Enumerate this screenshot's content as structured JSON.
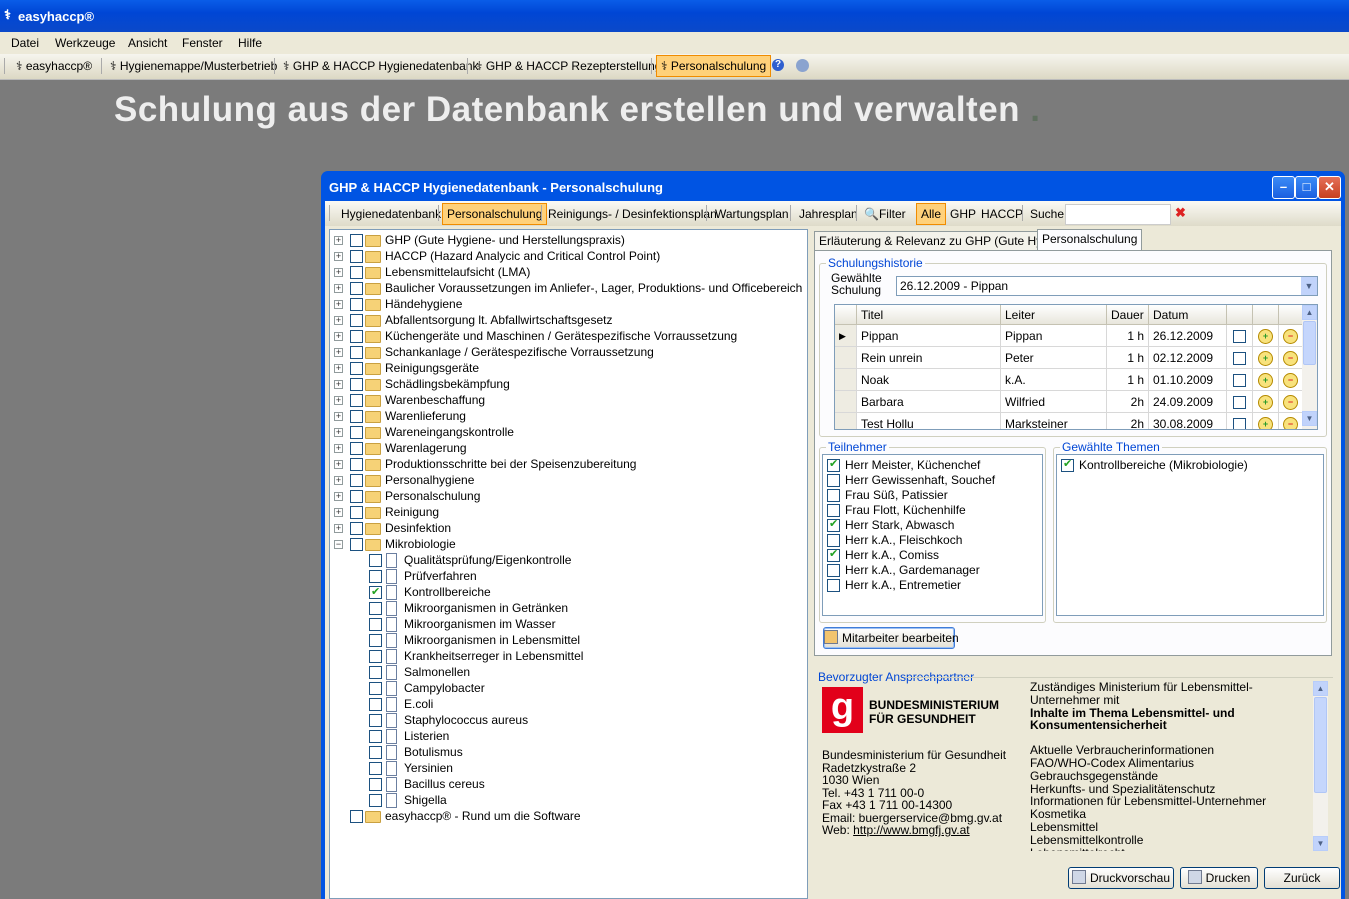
{
  "app": {
    "title": "easyhaccp®"
  },
  "menu": [
    "Datei",
    "Werkzeuge",
    "Ansicht",
    "Fenster",
    "Hilfe"
  ],
  "toolbar": {
    "items": [
      "easyhaccp®",
      "Hygienemappe/Musterbetrieb",
      "GHP & HACCP Hygienedatenbank",
      "GHP & HACCP Rezepterstellung",
      "Personalschulung"
    ],
    "active": "Personalschulung"
  },
  "headline": {
    "text": "Schulung aus der Datenbank erstellen  und verwalten",
    "dot": "."
  },
  "window": {
    "title": "GHP & HACCP Hygienedatenbank - Personalschulung",
    "toolbar": [
      "Hygienedatenbank",
      "Personalschulung",
      "Reinigungs- / Desinfektionsplan",
      "Wartungsplan",
      "Jahresplan",
      "Filter",
      "Alle",
      "GHP",
      "HACCP",
      "Suche"
    ],
    "search_value": ""
  },
  "tree": {
    "top": [
      {
        "label": "GHP (Gute Hygiene- und Herstellungspraxis)",
        "checked": false
      },
      {
        "label": "HACCP (Hazard Analycic and Critical Control Point)",
        "checked": false
      },
      {
        "label": "Lebensmittelaufsicht (LMA)",
        "checked": false
      },
      {
        "label": "Baulicher Voraussetzungen im Anliefer-, Lager, Produktions- und Officebereich",
        "checked": false
      },
      {
        "label": "Händehygiene",
        "checked": false
      },
      {
        "label": "Abfallentsorgung lt. Abfallwirtschaftsgesetz",
        "checked": false
      },
      {
        "label": "Küchengeräte und Maschinen / Gerätespezifische Vorraussetzung",
        "checked": false
      },
      {
        "label": "Schankanlage / Gerätespezifische Vorraussetzung",
        "checked": false
      },
      {
        "label": "Reinigungsgeräte",
        "checked": false
      },
      {
        "label": "Schädlingsbekämpfung",
        "checked": false
      },
      {
        "label": "Warenbeschaffung",
        "checked": false
      },
      {
        "label": "Warenlieferung",
        "checked": false
      },
      {
        "label": "Wareneingangskontrolle",
        "checked": false
      },
      {
        "label": "Warenlagerung",
        "checked": false
      },
      {
        "label": "Produktionsschritte bei der Speisenzubereitung",
        "checked": false
      },
      {
        "label": "Personalhygiene",
        "checked": false
      },
      {
        "label": "Personalschulung",
        "checked": false
      },
      {
        "label": "Reinigung",
        "checked": false
      },
      {
        "label": "Desinfektion",
        "checked": false
      },
      {
        "label": "Mikrobiologie",
        "checked": false,
        "expanded": true
      }
    ],
    "children": [
      {
        "label": "Qualitätsprüfung/Eigenkontrolle",
        "checked": false
      },
      {
        "label": "Prüfverfahren",
        "checked": false
      },
      {
        "label": "Kontrollbereiche",
        "checked": true
      },
      {
        "label": "Mikroorganismen in Getränken",
        "checked": false
      },
      {
        "label": "Mikroorganismen im Wasser",
        "checked": false
      },
      {
        "label": "Mikroorganismen in Lebensmittel",
        "checked": false
      },
      {
        "label": "Krankheitserreger in Lebensmittel",
        "checked": false
      },
      {
        "label": "Salmonellen",
        "checked": false
      },
      {
        "label": "Campylobacter",
        "checked": false
      },
      {
        "label": "E.coli",
        "checked": false
      },
      {
        "label": "Staphylococcus aureus",
        "checked": false
      },
      {
        "label": "Listerien",
        "checked": false
      },
      {
        "label": "Botulismus",
        "checked": false
      },
      {
        "label": "Yersinien",
        "checked": false
      },
      {
        "label": "Bacillus cereus",
        "checked": false
      },
      {
        "label": "Shigella",
        "checked": false
      }
    ],
    "last": {
      "label": "easyhaccp® - Rund um die Software",
      "checked": false
    }
  },
  "tabs": [
    "Erläuterung & Relevanz zu GHP (Gute Hygi...",
    "Personalschulung"
  ],
  "history": {
    "group_label": "Schulungshistorie",
    "select_label": "Gewählte Schulung",
    "selected": "26.12.2009 - Pippan",
    "columns": [
      "Titel",
      "Leiter",
      "Dauer",
      "Datum"
    ],
    "rows": [
      {
        "titel": "Pippan",
        "leiter": "Pippan",
        "dauer": "1 h",
        "datum": "26.12.2009"
      },
      {
        "titel": "Rein unrein",
        "leiter": "Peter",
        "dauer": "1 h",
        "datum": "02.12.2009"
      },
      {
        "titel": "Noak",
        "leiter": "k.A.",
        "dauer": "1 h",
        "datum": "01.10.2009"
      },
      {
        "titel": "Barbara",
        "leiter": "Wilfried",
        "dauer": "2h",
        "datum": "24.09.2009"
      },
      {
        "titel": "Test Hollu",
        "leiter": "Marksteiner",
        "dauer": "2h",
        "datum": "30.08.2009"
      }
    ]
  },
  "participants": {
    "group_label": "Teilnehmer",
    "items": [
      {
        "name": "Herr Meister, Küchenchef",
        "checked": true
      },
      {
        "name": "Herr Gewissenhaft, Souchef",
        "checked": false
      },
      {
        "name": "Frau Süß, Patissier",
        "checked": false
      },
      {
        "name": "Frau Flott, Küchenhilfe",
        "checked": false
      },
      {
        "name": "Herr Stark, Abwasch",
        "checked": true
      },
      {
        "name": "Herr k.A., Fleischkoch",
        "checked": false
      },
      {
        "name": "Herr k.A., Comiss",
        "checked": true
      },
      {
        "name": "Herr k.A., Gardemanager",
        "checked": false
      },
      {
        "name": "Herr k.A., Entremetier",
        "checked": false
      }
    ]
  },
  "themes": {
    "group_label": "Gewählte Themen",
    "items": [
      {
        "name": "Kontrollbereiche (Mikrobiologie)",
        "checked": true
      }
    ]
  },
  "edit_button": "Mitarbeiter bearbeiten",
  "contact": {
    "group_label": "Bevorzugter Ansprechpartner",
    "logo_letter": "g",
    "logo_line1": "BUNDESMINISTERIUM",
    "logo_line2": "FÜR GESUNDHEIT",
    "address": [
      "Bundesministerium  für  Gesundheit",
      "Radetzkystraße 2",
      "1030 Wien",
      "Tel. +43 1 711 00-0",
      "Fax +43 1 711 00-14300",
      "Email: buergerservice@bmg.gv.at"
    ],
    "web_label": "Web: ",
    "web": "http://www.bmgfj.gv.at",
    "info_intro": "Zuständiges Ministerium für Lebensmittel-Unternehmer mit",
    "info_bold": "Inhalte im Thema Lebensmittel- und Konsumentensicherheit",
    "info_items": [
      "Aktuelle Verbraucherinformationen",
      "FAO/WHO-Codex Alimentarius",
      "Gebrauchsgegenstände",
      "Herkunfts- und Spezialitätenschutz",
      "Informationen für Lebensmittel-Unternehmer",
      "Kosmetika",
      "Lebensmittel",
      "Lebensmittelkontrolle",
      "Lebensmittelrecht"
    ]
  },
  "buttons": {
    "preview": "Druckvorschau",
    "print": "Drucken",
    "back": "Zurück"
  },
  "colors": {
    "titlebar": "#0054e3",
    "highlight": "#ffd17a",
    "group_label": "#0046d5",
    "logo_red": "#e2001a"
  }
}
